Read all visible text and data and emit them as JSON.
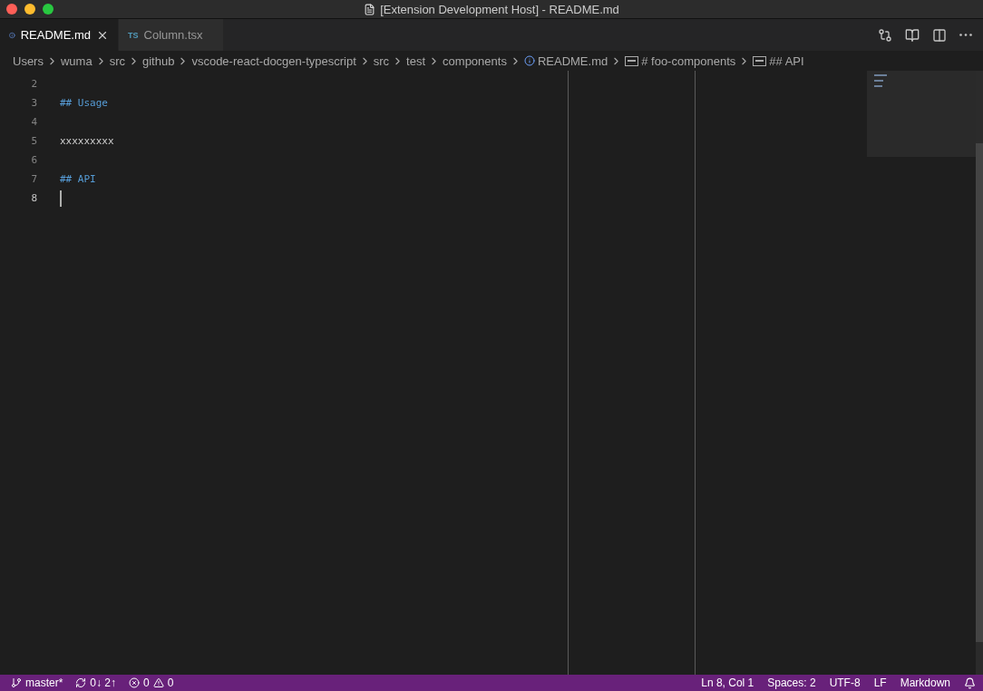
{
  "window": {
    "title": "[Extension Development Host] - README.md"
  },
  "tabs": [
    {
      "label": "README.md",
      "selected": true,
      "kind": "info"
    },
    {
      "label": "Column.tsx",
      "selected": false,
      "kind": "lang",
      "icon_label": "TS"
    }
  ],
  "breadcrumbs": [
    {
      "label": "Users",
      "kind": "folder"
    },
    {
      "label": "wuma",
      "kind": "folder"
    },
    {
      "label": "src",
      "kind": "folder"
    },
    {
      "label": "github",
      "kind": "folder"
    },
    {
      "label": "vscode-react-docgen-typescript",
      "kind": "folder"
    },
    {
      "label": "src",
      "kind": "folder"
    },
    {
      "label": "test",
      "kind": "folder"
    },
    {
      "label": "components",
      "kind": "folder"
    },
    {
      "label": "README.md",
      "kind": "file"
    },
    {
      "label": "# foo-components",
      "kind": "symbol"
    },
    {
      "label": "## API",
      "kind": "symbol"
    }
  ],
  "editor": {
    "lines": [
      {
        "number": "2",
        "cursor": false
      },
      {
        "number": "3",
        "kind": "heading",
        "text": "## Usage",
        "cursor": false
      },
      {
        "number": "4",
        "cursor": false
      },
      {
        "number": "5",
        "kind": "text",
        "text": "xxxxxxxxx",
        "cursor": false
      },
      {
        "number": "6",
        "cursor": false
      },
      {
        "number": "7",
        "kind": "heading",
        "text": "## API",
        "cursor": false
      },
      {
        "number": "8",
        "cursor": true
      }
    ]
  },
  "status_bar": {
    "branch": "master*",
    "sync": "0↓ 2↑",
    "errors": "0",
    "warnings": "0",
    "right": [
      "Ln 8, Col 1",
      "Spaces: 2",
      "UTF-8",
      "LF",
      "Markdown"
    ]
  }
}
